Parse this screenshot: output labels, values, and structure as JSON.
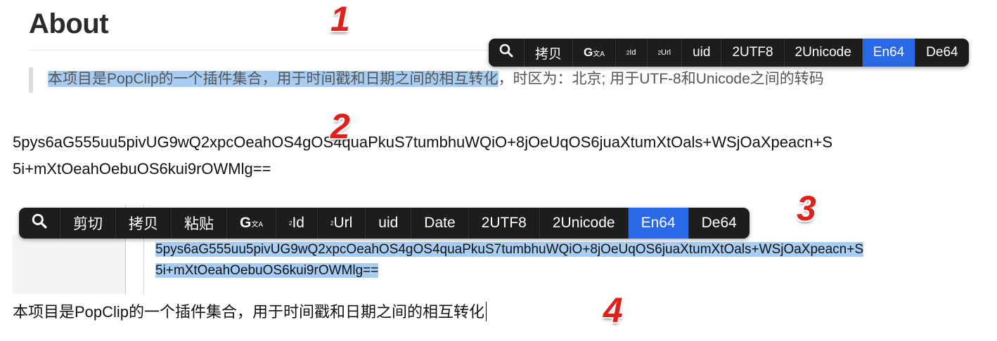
{
  "heading": "About",
  "quote": {
    "selected_text": "本项目是PopClip的一个插件集合，用于时间戳和日期之间的相互转化",
    "rest_text": "，时区为：北京; 用于UTF-8和Unicode之间的转码"
  },
  "base64_output": {
    "line1": "5pys6aG555uu5pivUG9wQ2xpcOeahOS4gOS4quaPkuS7tumbhuWQiO+8jOeUqOS6juaXtumXtOals+WSjOaXpeacn+S",
    "line2": "5i+mXtOeahOebuOS6kui9rOWMlg=="
  },
  "toolbar1": {
    "items": [
      "search",
      "拷贝",
      "G",
      "Id",
      "Url",
      "uid",
      "2UTF8",
      "2Unicode",
      "En64",
      "De64"
    ],
    "active": "En64"
  },
  "toolbar3": {
    "items": [
      "search",
      "剪切",
      "拷贝",
      "粘贴",
      "G",
      "Id",
      "Url",
      "uid",
      "Date",
      "2UTF8",
      "2Unicode",
      "En64",
      "De64"
    ],
    "active": "En64"
  },
  "editor_selection": {
    "line1": "5pys6aG555uu5pivUG9wQ2xpcOeahOS4gOS4quaPkuS7tumbhuWQiO+8jOeUqOS6juaXtumXtOals+WSjOaXpeacn+S",
    "line2": "5i+mXtOeahOebuOS6kui9rOWMlg=="
  },
  "decoded_text": "本项目是PopClip的一个插件集合，用于时间戳和日期之间的相互转化",
  "step_labels": [
    "1",
    "2",
    "3",
    "4"
  ],
  "colors": {
    "toolbar_bg": "#1d1d1d",
    "active_item": "#2a68e6",
    "selection": "#a8cdf3",
    "step_number": "#e0201a"
  }
}
